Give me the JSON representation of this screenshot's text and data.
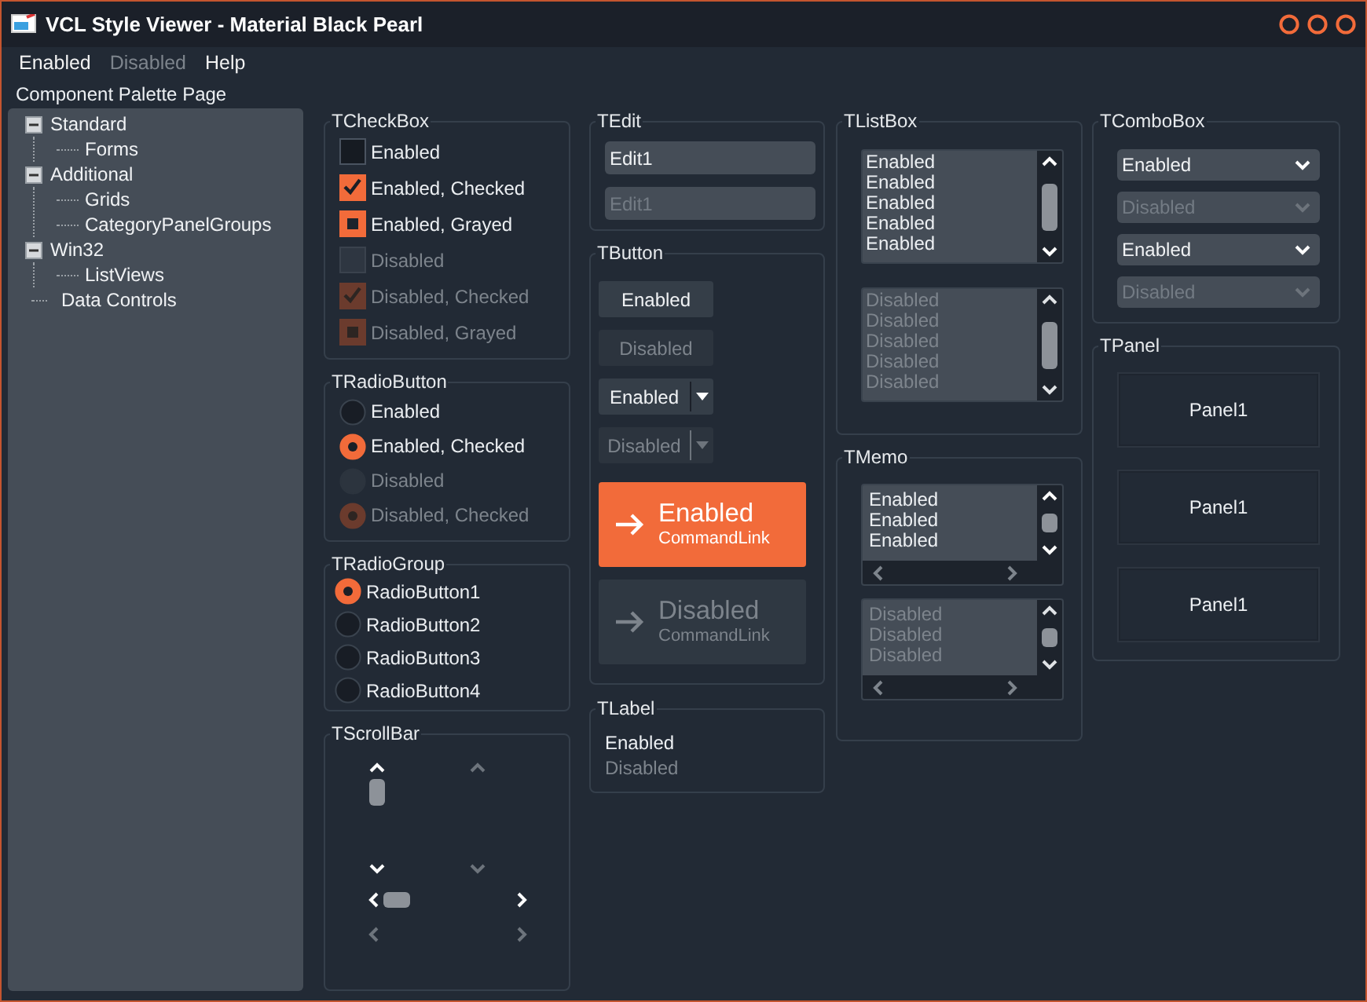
{
  "window": {
    "title": "VCL Style Viewer - Material Black Pearl"
  },
  "menu": [
    {
      "label": "Enabled",
      "disabled": false
    },
    {
      "label": "Disabled",
      "disabled": true
    },
    {
      "label": "Help",
      "disabled": false
    }
  ],
  "palette_label": "Component Palette Page",
  "tree": [
    {
      "label": "Standard",
      "expanded": true,
      "children": [
        {
          "label": "Forms"
        }
      ]
    },
    {
      "label": "Additional",
      "expanded": true,
      "children": [
        {
          "label": "Grids"
        },
        {
          "label": "CategoryPanelGroups"
        }
      ]
    },
    {
      "label": "Win32",
      "expanded": true,
      "children": [
        {
          "label": "ListViews"
        }
      ]
    },
    {
      "label": "Data Controls"
    }
  ],
  "checkbox_group": {
    "title": "TCheckBox",
    "items": [
      {
        "label": "Enabled",
        "checked": false,
        "grayed": false,
        "disabled": false
      },
      {
        "label": "Enabled, Checked",
        "checked": true,
        "grayed": false,
        "disabled": false
      },
      {
        "label": "Enabled, Grayed",
        "checked": false,
        "grayed": true,
        "disabled": false
      },
      {
        "label": "Disabled",
        "checked": false,
        "grayed": false,
        "disabled": true
      },
      {
        "label": "Disabled, Checked",
        "checked": true,
        "grayed": false,
        "disabled": true
      },
      {
        "label": "Disabled, Grayed",
        "checked": false,
        "grayed": true,
        "disabled": true
      }
    ]
  },
  "radiobutton_group": {
    "title": "TRadioButton",
    "items": [
      {
        "label": "Enabled",
        "selected": false,
        "disabled": false
      },
      {
        "label": "Enabled, Checked",
        "selected": true,
        "disabled": false
      },
      {
        "label": "Disabled",
        "selected": false,
        "disabled": true
      },
      {
        "label": "Disabled, Checked",
        "selected": true,
        "disabled": true
      }
    ]
  },
  "radio_group": {
    "title": "TRadioGroup",
    "items": [
      {
        "label": "RadioButton1",
        "selected": true
      },
      {
        "label": "RadioButton2",
        "selected": false
      },
      {
        "label": "RadioButton3",
        "selected": false
      },
      {
        "label": "RadioButton4",
        "selected": false
      }
    ]
  },
  "scrollbar_group": {
    "title": "TScrollBar",
    "scrollbars": [
      {
        "kind": "vertical",
        "disabled": false
      },
      {
        "kind": "vertical",
        "disabled": true
      },
      {
        "kind": "horizontal",
        "disabled": false
      },
      {
        "kind": "horizontal",
        "disabled": true
      }
    ]
  },
  "edit_group": {
    "title": "TEdit",
    "fields": [
      {
        "value": "Edit1",
        "disabled": false
      },
      {
        "value": "Edit1",
        "disabled": true
      }
    ]
  },
  "button_group": {
    "title": "TButton",
    "buttons": [
      {
        "kind": "push",
        "label": "Enabled",
        "disabled": false
      },
      {
        "kind": "push",
        "label": "Disabled",
        "disabled": true
      },
      {
        "kind": "split",
        "label": "Enabled",
        "disabled": false
      },
      {
        "kind": "split",
        "label": "Disabled",
        "disabled": true
      },
      {
        "kind": "command_link",
        "label": "Enabled",
        "note": "CommandLink",
        "disabled": false
      },
      {
        "kind": "command_link",
        "label": "Disabled",
        "note": "CommandLink",
        "disabled": true
      }
    ]
  },
  "label_group": {
    "title": "TLabel",
    "labels": [
      {
        "text": "Enabled",
        "disabled": false
      },
      {
        "text": "Disabled",
        "disabled": true
      }
    ]
  },
  "listbox_group": {
    "title": "TListBox",
    "listboxes": [
      {
        "disabled": false,
        "items": [
          "Enabled",
          "Enabled",
          "Enabled",
          "Enabled",
          "Enabled"
        ]
      },
      {
        "disabled": true,
        "items": [
          "Disabled",
          "Disabled",
          "Disabled",
          "Disabled",
          "Disabled"
        ]
      }
    ]
  },
  "memo_group": {
    "title": "TMemo",
    "memos": [
      {
        "disabled": false,
        "lines": [
          "Enabled",
          "Enabled",
          "Enabled"
        ]
      },
      {
        "disabled": true,
        "lines": [
          "Disabled",
          "Disabled",
          "Disabled"
        ]
      }
    ]
  },
  "combo_group": {
    "title": "TComboBox",
    "combos": [
      {
        "value": "Enabled",
        "disabled": false
      },
      {
        "value": "Disabled",
        "disabled": true
      },
      {
        "value": "Enabled",
        "disabled": false
      },
      {
        "value": "Disabled",
        "disabled": true
      }
    ]
  },
  "panel_group": {
    "title": "TPanel",
    "panels": [
      "Panel1",
      "Panel1",
      "Panel1"
    ]
  }
}
